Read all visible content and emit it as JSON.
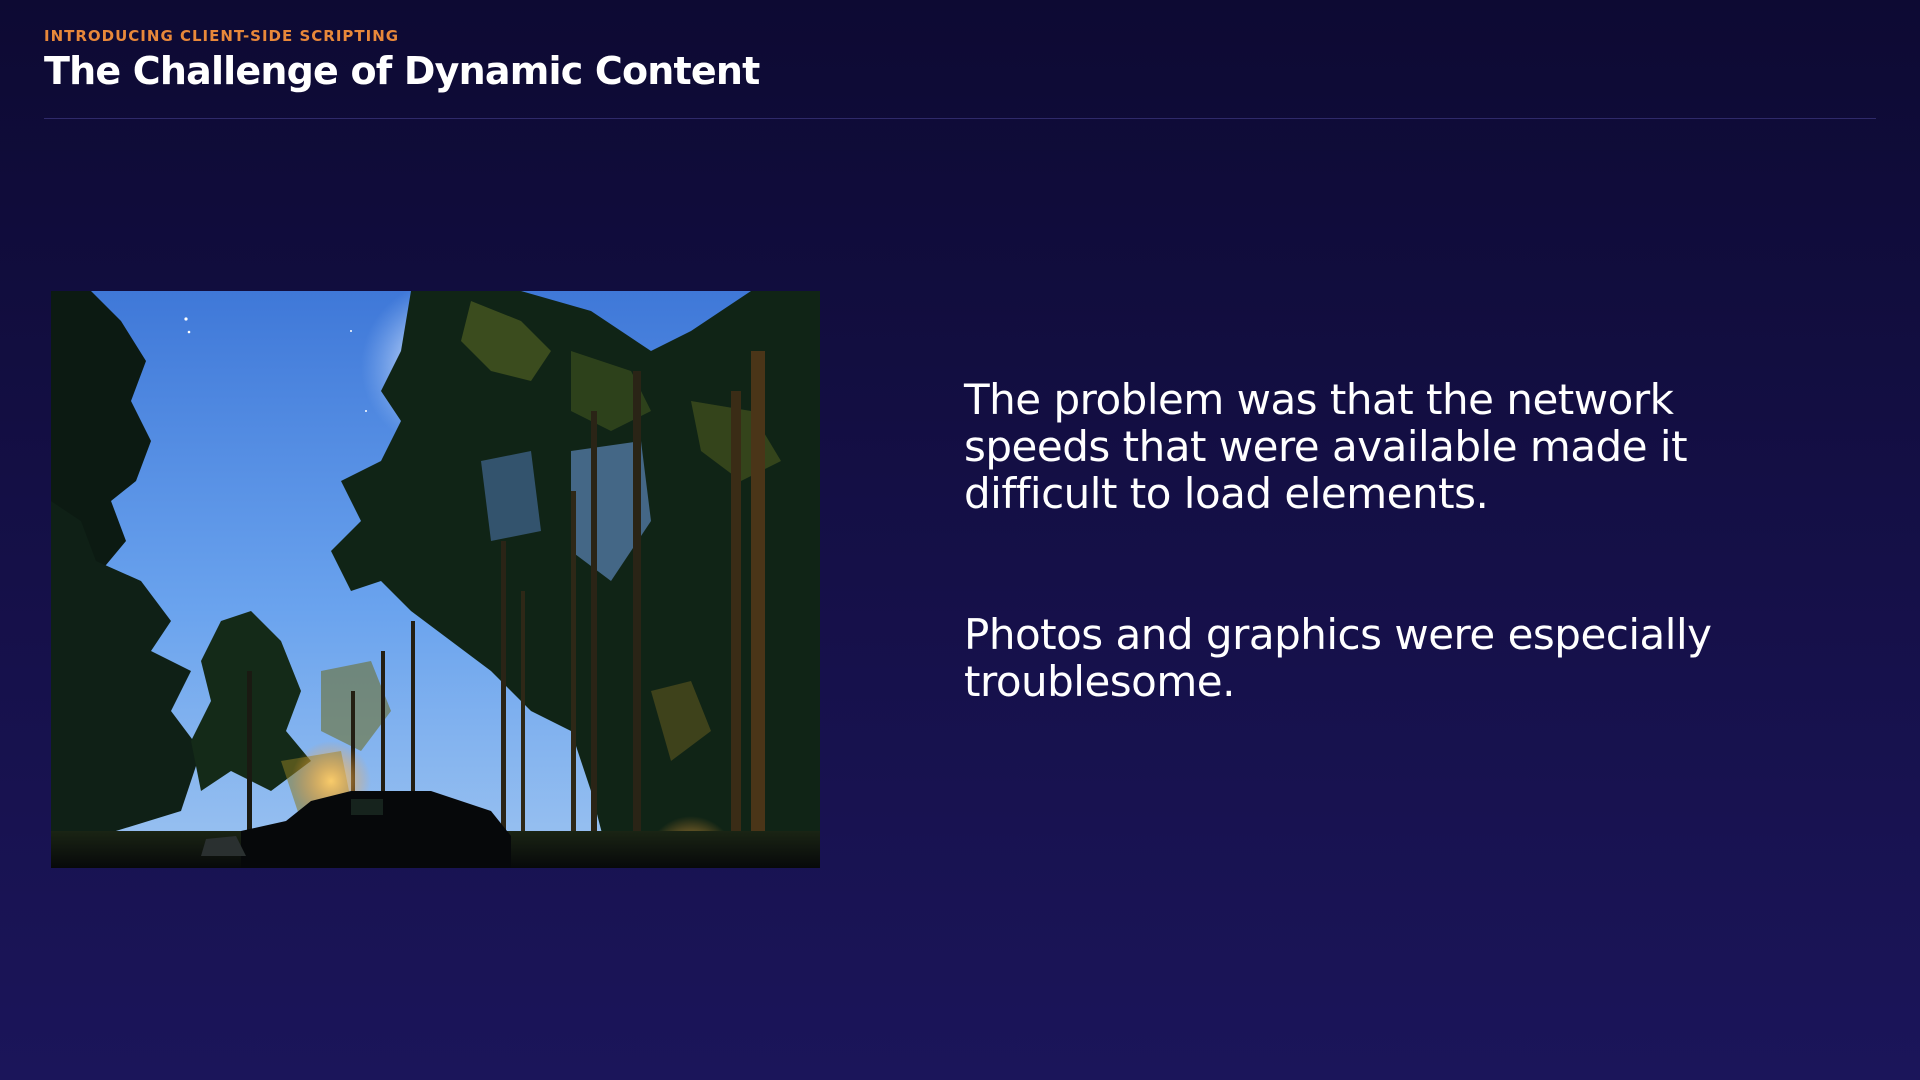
{
  "slide": {
    "eyebrow": "INTRODUCING CLIENT-SIDE SCRIPTING",
    "title": "The Challenge of Dynamic Content",
    "paragraphs": [
      "The problem was that the network speeds that were available made it difficult to load elements.",
      "Photos and graphics were especially troublesome."
    ]
  },
  "colors": {
    "background_top": "#0d0a33",
    "background_bottom": "#1b155a",
    "eyebrow": "#e8883a",
    "title": "#ffffff",
    "body_text": "#ffffff"
  }
}
